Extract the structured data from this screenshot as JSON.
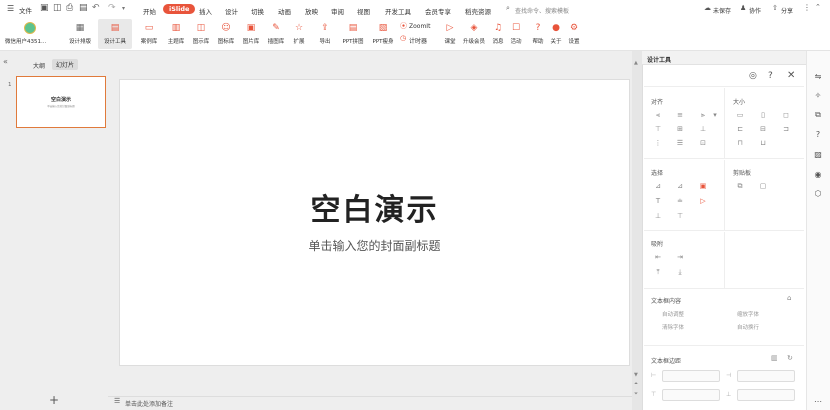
{
  "topbar": {
    "file_label": "文件",
    "search_placeholder": "查找命令、搜索模板",
    "unsaved": "未保存",
    "collab": "协作",
    "share": "分享"
  },
  "menu_tabs": [
    "开始",
    "iSlide",
    "插入",
    "设计",
    "切换",
    "动画",
    "放映",
    "审阅",
    "视图",
    "开发工具",
    "会员专享",
    "稻壳资源"
  ],
  "ribbon": {
    "user_name": "微信用户4351...",
    "design_layout": "设计排版",
    "design_tools": "设计工具",
    "items": [
      {
        "label": "案例库",
        "icon": "▭"
      },
      {
        "label": "主题库",
        "icon": "▥"
      },
      {
        "label": "图示库",
        "icon": "◫"
      },
      {
        "label": "图标库",
        "icon": "☺"
      },
      {
        "label": "图片库",
        "icon": "▣"
      },
      {
        "label": "插图库",
        "icon": "✎"
      },
      {
        "label": "扩展",
        "icon": "☆"
      },
      {
        "label": "导出",
        "icon": "⇪"
      },
      {
        "label": "PPT拼图",
        "icon": "▤"
      },
      {
        "label": "PPT瘦身",
        "icon": "▧"
      }
    ],
    "zoomit": "ZoomIt",
    "timer": "计时器",
    "items2": [
      {
        "label": "课堂",
        "icon": "▷"
      },
      {
        "label": "升级会员",
        "icon": "◈"
      },
      {
        "label": "消息",
        "icon": "♫"
      },
      {
        "label": "活动",
        "icon": "☐"
      },
      {
        "label": "帮助",
        "icon": "?"
      },
      {
        "label": "关于",
        "icon": "●"
      },
      {
        "label": "设置",
        "icon": "⚙"
      }
    ]
  },
  "left_panel": {
    "tab_outline": "大纲",
    "tab_slides": "幻灯片",
    "slide_number": "1",
    "thumb_title": "空白演示",
    "thumb_sub": "单击输入您的封面副标题",
    "add": "+"
  },
  "slide": {
    "title": "空白演示",
    "subtitle": "单击输入您的封面副标题"
  },
  "notes": {
    "placeholder": "单击此处添加备注"
  },
  "right_panel": {
    "title": "设计工具",
    "sections": {
      "align": "对齐",
      "size": "大小",
      "select": "选择",
      "clip": "剪贴板",
      "snap": "吸附",
      "text_content": "文本框内容",
      "text_margin": "文本框边距"
    },
    "text_options": {
      "auto_fit": "自动调整",
      "shrink": "缩放字体",
      "clear": "清除字体",
      "auto_wrap": "自动换行"
    }
  }
}
